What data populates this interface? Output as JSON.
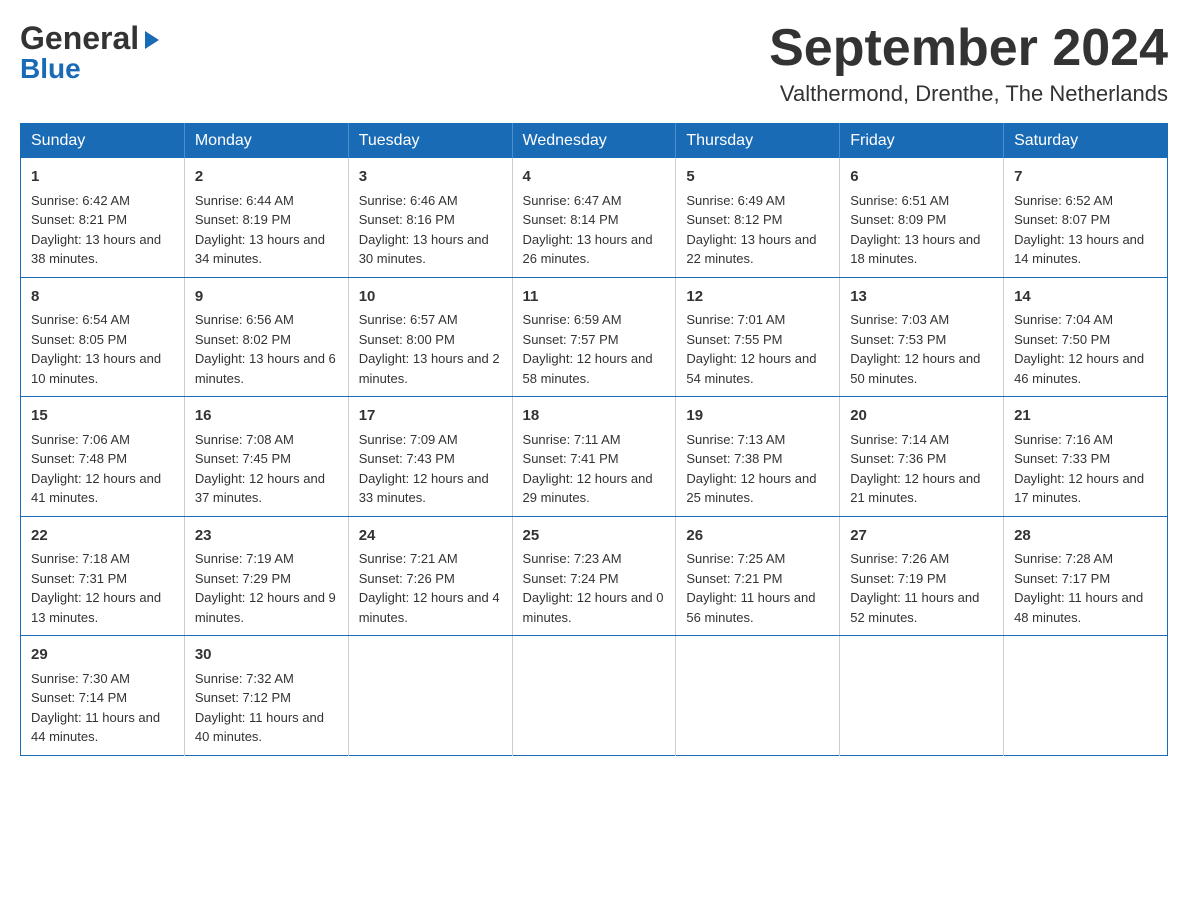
{
  "header": {
    "logo_line1": "General",
    "logo_arrow": "▶",
    "logo_line2": "Blue",
    "month_year": "September 2024",
    "location": "Valthermond, Drenthe, The Netherlands"
  },
  "days_of_week": [
    "Sunday",
    "Monday",
    "Tuesday",
    "Wednesday",
    "Thursday",
    "Friday",
    "Saturday"
  ],
  "weeks": [
    [
      {
        "day": "1",
        "sunrise": "Sunrise: 6:42 AM",
        "sunset": "Sunset: 8:21 PM",
        "daylight": "Daylight: 13 hours and 38 minutes."
      },
      {
        "day": "2",
        "sunrise": "Sunrise: 6:44 AM",
        "sunset": "Sunset: 8:19 PM",
        "daylight": "Daylight: 13 hours and 34 minutes."
      },
      {
        "day": "3",
        "sunrise": "Sunrise: 6:46 AM",
        "sunset": "Sunset: 8:16 PM",
        "daylight": "Daylight: 13 hours and 30 minutes."
      },
      {
        "day": "4",
        "sunrise": "Sunrise: 6:47 AM",
        "sunset": "Sunset: 8:14 PM",
        "daylight": "Daylight: 13 hours and 26 minutes."
      },
      {
        "day": "5",
        "sunrise": "Sunrise: 6:49 AM",
        "sunset": "Sunset: 8:12 PM",
        "daylight": "Daylight: 13 hours and 22 minutes."
      },
      {
        "day": "6",
        "sunrise": "Sunrise: 6:51 AM",
        "sunset": "Sunset: 8:09 PM",
        "daylight": "Daylight: 13 hours and 18 minutes."
      },
      {
        "day": "7",
        "sunrise": "Sunrise: 6:52 AM",
        "sunset": "Sunset: 8:07 PM",
        "daylight": "Daylight: 13 hours and 14 minutes."
      }
    ],
    [
      {
        "day": "8",
        "sunrise": "Sunrise: 6:54 AM",
        "sunset": "Sunset: 8:05 PM",
        "daylight": "Daylight: 13 hours and 10 minutes."
      },
      {
        "day": "9",
        "sunrise": "Sunrise: 6:56 AM",
        "sunset": "Sunset: 8:02 PM",
        "daylight": "Daylight: 13 hours and 6 minutes."
      },
      {
        "day": "10",
        "sunrise": "Sunrise: 6:57 AM",
        "sunset": "Sunset: 8:00 PM",
        "daylight": "Daylight: 13 hours and 2 minutes."
      },
      {
        "day": "11",
        "sunrise": "Sunrise: 6:59 AM",
        "sunset": "Sunset: 7:57 PM",
        "daylight": "Daylight: 12 hours and 58 minutes."
      },
      {
        "day": "12",
        "sunrise": "Sunrise: 7:01 AM",
        "sunset": "Sunset: 7:55 PM",
        "daylight": "Daylight: 12 hours and 54 minutes."
      },
      {
        "day": "13",
        "sunrise": "Sunrise: 7:03 AM",
        "sunset": "Sunset: 7:53 PM",
        "daylight": "Daylight: 12 hours and 50 minutes."
      },
      {
        "day": "14",
        "sunrise": "Sunrise: 7:04 AM",
        "sunset": "Sunset: 7:50 PM",
        "daylight": "Daylight: 12 hours and 46 minutes."
      }
    ],
    [
      {
        "day": "15",
        "sunrise": "Sunrise: 7:06 AM",
        "sunset": "Sunset: 7:48 PM",
        "daylight": "Daylight: 12 hours and 41 minutes."
      },
      {
        "day": "16",
        "sunrise": "Sunrise: 7:08 AM",
        "sunset": "Sunset: 7:45 PM",
        "daylight": "Daylight: 12 hours and 37 minutes."
      },
      {
        "day": "17",
        "sunrise": "Sunrise: 7:09 AM",
        "sunset": "Sunset: 7:43 PM",
        "daylight": "Daylight: 12 hours and 33 minutes."
      },
      {
        "day": "18",
        "sunrise": "Sunrise: 7:11 AM",
        "sunset": "Sunset: 7:41 PM",
        "daylight": "Daylight: 12 hours and 29 minutes."
      },
      {
        "day": "19",
        "sunrise": "Sunrise: 7:13 AM",
        "sunset": "Sunset: 7:38 PM",
        "daylight": "Daylight: 12 hours and 25 minutes."
      },
      {
        "day": "20",
        "sunrise": "Sunrise: 7:14 AM",
        "sunset": "Sunset: 7:36 PM",
        "daylight": "Daylight: 12 hours and 21 minutes."
      },
      {
        "day": "21",
        "sunrise": "Sunrise: 7:16 AM",
        "sunset": "Sunset: 7:33 PM",
        "daylight": "Daylight: 12 hours and 17 minutes."
      }
    ],
    [
      {
        "day": "22",
        "sunrise": "Sunrise: 7:18 AM",
        "sunset": "Sunset: 7:31 PM",
        "daylight": "Daylight: 12 hours and 13 minutes."
      },
      {
        "day": "23",
        "sunrise": "Sunrise: 7:19 AM",
        "sunset": "Sunset: 7:29 PM",
        "daylight": "Daylight: 12 hours and 9 minutes."
      },
      {
        "day": "24",
        "sunrise": "Sunrise: 7:21 AM",
        "sunset": "Sunset: 7:26 PM",
        "daylight": "Daylight: 12 hours and 4 minutes."
      },
      {
        "day": "25",
        "sunrise": "Sunrise: 7:23 AM",
        "sunset": "Sunset: 7:24 PM",
        "daylight": "Daylight: 12 hours and 0 minutes."
      },
      {
        "day": "26",
        "sunrise": "Sunrise: 7:25 AM",
        "sunset": "Sunset: 7:21 PM",
        "daylight": "Daylight: 11 hours and 56 minutes."
      },
      {
        "day": "27",
        "sunrise": "Sunrise: 7:26 AM",
        "sunset": "Sunset: 7:19 PM",
        "daylight": "Daylight: 11 hours and 52 minutes."
      },
      {
        "day": "28",
        "sunrise": "Sunrise: 7:28 AM",
        "sunset": "Sunset: 7:17 PM",
        "daylight": "Daylight: 11 hours and 48 minutes."
      }
    ],
    [
      {
        "day": "29",
        "sunrise": "Sunrise: 7:30 AM",
        "sunset": "Sunset: 7:14 PM",
        "daylight": "Daylight: 11 hours and 44 minutes."
      },
      {
        "day": "30",
        "sunrise": "Sunrise: 7:32 AM",
        "sunset": "Sunset: 7:12 PM",
        "daylight": "Daylight: 11 hours and 40 minutes."
      },
      {
        "day": "",
        "sunrise": "",
        "sunset": "",
        "daylight": ""
      },
      {
        "day": "",
        "sunrise": "",
        "sunset": "",
        "daylight": ""
      },
      {
        "day": "",
        "sunrise": "",
        "sunset": "",
        "daylight": ""
      },
      {
        "day": "",
        "sunrise": "",
        "sunset": "",
        "daylight": ""
      },
      {
        "day": "",
        "sunrise": "",
        "sunset": "",
        "daylight": ""
      }
    ]
  ]
}
